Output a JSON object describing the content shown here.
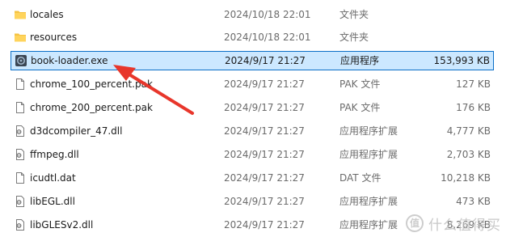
{
  "files": [
    {
      "name": "locales",
      "date": "2024/10/18 22:01",
      "type": "文件夹",
      "size": "",
      "icon": "folder-icon",
      "selected": false
    },
    {
      "name": "resources",
      "date": "2024/10/18 22:01",
      "type": "文件夹",
      "size": "",
      "icon": "folder-icon",
      "selected": false
    },
    {
      "name": "book-loader.exe",
      "date": "2024/9/17 21:27",
      "type": "应用程序",
      "size": "153,993 KB",
      "icon": "exe-icon",
      "selected": true
    },
    {
      "name": "chrome_100_percent.pak",
      "date": "2024/9/17 21:27",
      "type": "PAK 文件",
      "size": "127 KB",
      "icon": "document-icon",
      "selected": false
    },
    {
      "name": "chrome_200_percent.pak",
      "date": "2024/9/17 21:27",
      "type": "PAK 文件",
      "size": "176 KB",
      "icon": "document-icon",
      "selected": false
    },
    {
      "name": "d3dcompiler_47.dll",
      "date": "2024/9/17 21:27",
      "type": "应用程序扩展",
      "size": "4,777 KB",
      "icon": "dll-icon",
      "selected": false
    },
    {
      "name": "ffmpeg.dll",
      "date": "2024/9/17 21:27",
      "type": "应用程序扩展",
      "size": "2,703 KB",
      "icon": "dll-icon",
      "selected": false
    },
    {
      "name": "icudtl.dat",
      "date": "2024/9/17 21:27",
      "type": "DAT 文件",
      "size": "10,218 KB",
      "icon": "document-icon",
      "selected": false
    },
    {
      "name": "libEGL.dll",
      "date": "2024/9/17 21:27",
      "type": "应用程序扩展",
      "size": "473 KB",
      "icon": "dll-icon",
      "selected": false
    },
    {
      "name": "libGLESv2.dll",
      "date": "2024/9/17 21:27",
      "type": "应用程序扩展",
      "size": "8,269 KB",
      "icon": "dll-icon",
      "selected": false
    }
  ],
  "watermark": {
    "badge": "值",
    "text": "什么值得买"
  },
  "colors": {
    "selection_bg": "#cce8ff",
    "selection_border": "#0b6fc7",
    "arrow": "#e8362b",
    "folder": "#f5c343"
  }
}
